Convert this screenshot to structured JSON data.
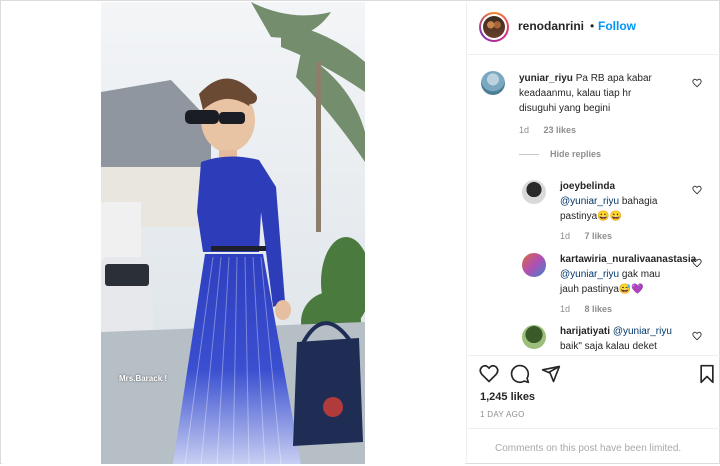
{
  "header": {
    "username": "renodanrini",
    "separator": "•",
    "follow_label": "Follow"
  },
  "media": {
    "watermark": "Mrs.Barack !"
  },
  "comments": [
    {
      "username": "yuniar_riyu",
      "text_line1": "Pa RB apa kabar",
      "text_line2": "keadaanmu, kalau tiap hr",
      "text_line3": "disuguhi yang begini",
      "age": "1d",
      "likes": "23 likes"
    }
  ],
  "hide_replies_label": "Hide replies",
  "replies": [
    {
      "username": "joeybelinda",
      "mention": "@yuniar_riyu",
      "text_after_mention": " bahagia",
      "text_line2": "pastinya😀😀",
      "age": "1d",
      "likes": "7 likes"
    },
    {
      "username": "kartawiria_nuralivaanastasia",
      "mention": "@yuniar_riyu",
      "text_after_mention": " gak mau",
      "text_line2": "jauh pastinya😅💜",
      "age": "1d",
      "likes": "8 likes"
    },
    {
      "username": "harijatiyati",
      "mention": "@yuniar_riyu",
      "text_line2": "baik\" saja kalau deket"
    }
  ],
  "footer": {
    "likes": "1,245 likes",
    "date": "1 DAY AGO",
    "limited_text": "Comments on this post have been limited."
  },
  "icons": {
    "like": "heart-icon",
    "comment": "comment-icon",
    "share": "share-icon",
    "save": "bookmark-icon"
  },
  "colors": {
    "link": "#0095f6",
    "mention": "#00376b",
    "muted": "#8e8e8e"
  }
}
